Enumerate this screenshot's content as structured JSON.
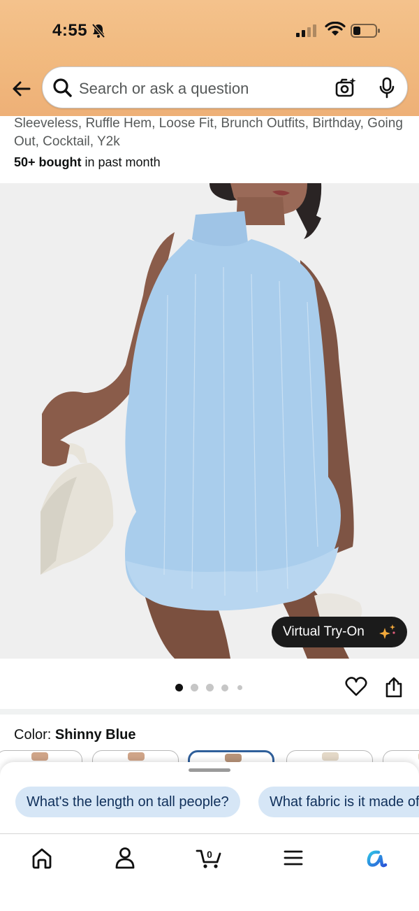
{
  "status_bar": {
    "time": "4:55"
  },
  "search": {
    "placeholder": "Search or ask a question"
  },
  "product": {
    "title_fragment": "Sleeveless, Ruffle Hem, Loose Fit, Brunch Outfits, Birthday, Going Out, Cocktail, Y2k",
    "bought_bold": "50+ bought",
    "bought_rest": " in past month"
  },
  "image": {
    "virtual_tryon_label": "Virtual Try-On",
    "carousel_total": 5,
    "carousel_active": 1
  },
  "color": {
    "label": "Color: ",
    "value": "Shinny Blue"
  },
  "suggestions": [
    "What's the length on tall people?",
    "What fabric is it made of?"
  ],
  "tab_bar": {
    "cart_count": "0",
    "items": [
      "home-icon",
      "account-icon",
      "cart-icon",
      "menu-icon",
      "rufus-icon"
    ]
  },
  "colors": {
    "accent_blue": "#2f5f9a",
    "chip_bg": "#d6e6f6",
    "header_orange": "#f1b97e",
    "dress_blue": "#a9cdec"
  }
}
